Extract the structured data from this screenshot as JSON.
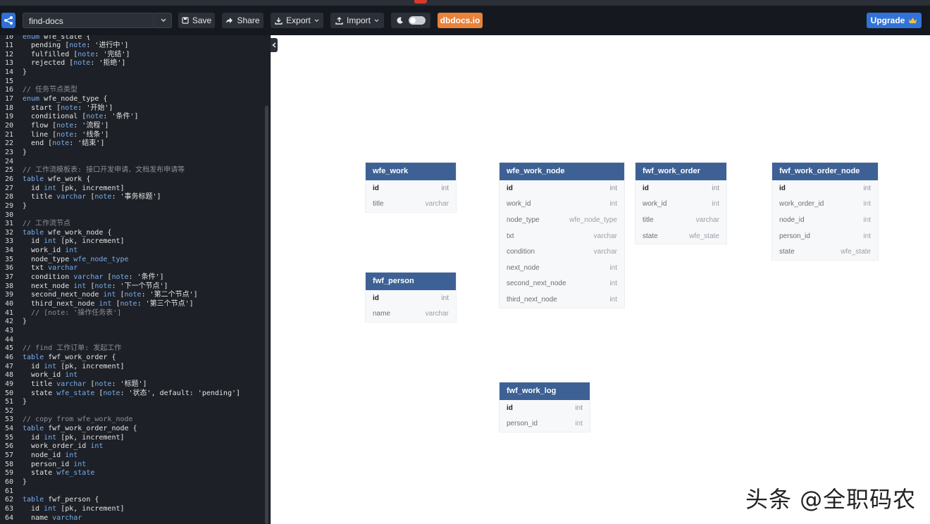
{
  "toolbar": {
    "doc_name": "find-docs",
    "save_label": "Save",
    "share_label": "Share",
    "export_label": "Export",
    "import_label": "Import",
    "dbdocs_label": "dbdocs.io",
    "upgrade_label": "Upgrade"
  },
  "editor": {
    "lines": [
      {
        "n": "10",
        "html": "<span class=\"kw\">enum</span> wfe_state {"
      },
      {
        "n": "11",
        "html": "  pending [<span class=\"kw\">note</span>: '进行中']"
      },
      {
        "n": "12",
        "html": "  fulfilled [<span class=\"kw\">note</span>: '完结']"
      },
      {
        "n": "13",
        "html": "  rejected [<span class=\"kw\">note</span>: '拒绝']"
      },
      {
        "n": "14",
        "html": "}"
      },
      {
        "n": "15",
        "html": ""
      },
      {
        "n": "16",
        "html": "<span class=\"cm\">// 任务节点类型</span>"
      },
      {
        "n": "17",
        "html": "<span class=\"kw\">enum</span> wfe_node_type {"
      },
      {
        "n": "18",
        "html": "  start [<span class=\"kw\">note</span>: '开始']"
      },
      {
        "n": "19",
        "html": "  conditional [<span class=\"kw\">note</span>: '条件']"
      },
      {
        "n": "20",
        "html": "  flow [<span class=\"kw\">note</span>: '流程']"
      },
      {
        "n": "21",
        "html": "  line [<span class=\"kw\">note</span>: '线条']"
      },
      {
        "n": "22",
        "html": "  end [<span class=\"kw\">note</span>: '结束']"
      },
      {
        "n": "23",
        "html": "}"
      },
      {
        "n": "24",
        "html": ""
      },
      {
        "n": "25",
        "html": "<span class=\"cm\">// 工作流模板表: 接口开发申请、文档发布申请等</span>"
      },
      {
        "n": "26",
        "html": "<span class=\"kw\">table</span> wfe_work {"
      },
      {
        "n": "27",
        "html": "  id <span class=\"kw\">int</span> [pk, increment]"
      },
      {
        "n": "28",
        "html": "  title <span class=\"kw\">varchar</span> [<span class=\"kw\">note</span>: '事务标题']"
      },
      {
        "n": "29",
        "html": "}"
      },
      {
        "n": "30",
        "html": ""
      },
      {
        "n": "31",
        "html": "<span class=\"cm\">// 工作流节点</span>"
      },
      {
        "n": "32",
        "html": "<span class=\"kw\">table</span> wfe_work_node {"
      },
      {
        "n": "33",
        "html": "  id <span class=\"kw\">int</span> [pk, increment]"
      },
      {
        "n": "34",
        "html": "  work_id <span class=\"kw\">int</span>"
      },
      {
        "n": "35",
        "html": "  node_type <span class=\"kw\">wfe_node_type</span>"
      },
      {
        "n": "36",
        "html": "  txt <span class=\"kw\">varchar</span>"
      },
      {
        "n": "37",
        "html": "  condition <span class=\"kw\">varchar</span> [<span class=\"kw\">note</span>: '条件']"
      },
      {
        "n": "38",
        "html": "  next_node <span class=\"kw\">int</span> [<span class=\"kw\">note</span>: '下一个节点']"
      },
      {
        "n": "39",
        "html": "  second_next_node <span class=\"kw\">int</span> [<span class=\"kw\">note</span>: '第二个节点']"
      },
      {
        "n": "40",
        "html": "  third_next_node <span class=\"kw\">int</span> [<span class=\"kw\">note</span>: '第三个节点']"
      },
      {
        "n": "41",
        "html": "  <span class=\"cm\">// [note: '操作任务表']</span>"
      },
      {
        "n": "42",
        "html": "}"
      },
      {
        "n": "43",
        "html": ""
      },
      {
        "n": "44",
        "html": ""
      },
      {
        "n": "45",
        "html": "<span class=\"cm\">// find 工作订单: 发起工作</span>"
      },
      {
        "n": "46",
        "html": "<span class=\"kw\">table</span> fwf_work_order {"
      },
      {
        "n": "47",
        "html": "  id <span class=\"kw\">int</span> [pk, increment]"
      },
      {
        "n": "48",
        "html": "  work_id <span class=\"kw\">int</span>"
      },
      {
        "n": "49",
        "html": "  title <span class=\"kw\">varchar</span> [<span class=\"kw\">note</span>: '标题']"
      },
      {
        "n": "50",
        "html": "  state <span class=\"kw\">wfe_state</span> [<span class=\"kw\">note</span>: '状态', default: 'pending']"
      },
      {
        "n": "51",
        "html": "}"
      },
      {
        "n": "52",
        "html": ""
      },
      {
        "n": "53",
        "html": "<span class=\"cm\">// copy from wfe_work_node</span>"
      },
      {
        "n": "54",
        "html": "<span class=\"kw\">table</span> fwf_work_order_node {"
      },
      {
        "n": "55",
        "html": "  id <span class=\"kw\">int</span> [pk, increment]"
      },
      {
        "n": "56",
        "html": "  work_order_id <span class=\"kw\">int</span>"
      },
      {
        "n": "57",
        "html": "  node_id <span class=\"kw\">int</span>"
      },
      {
        "n": "58",
        "html": "  person_id <span class=\"kw\">int</span>"
      },
      {
        "n": "59",
        "html": "  state <span class=\"kw\">wfe_state</span>"
      },
      {
        "n": "60",
        "html": "}"
      },
      {
        "n": "61",
        "html": ""
      },
      {
        "n": "62",
        "html": "<span class=\"kw\">table</span> fwf_person {"
      },
      {
        "n": "63",
        "html": "  id <span class=\"kw\">int</span> [pk, increment]"
      },
      {
        "n": "64",
        "html": "  name <span class=\"kw\">varchar</span>"
      }
    ]
  },
  "diagram": {
    "tables": [
      {
        "key": "wfe_work",
        "name": "wfe_work",
        "fields": [
          {
            "name": "id",
            "type": "int",
            "pk": true
          },
          {
            "name": "title",
            "type": "varchar"
          }
        ]
      },
      {
        "key": "wfe_work_node",
        "name": "wfe_work_node",
        "fields": [
          {
            "name": "id",
            "type": "int",
            "pk": true
          },
          {
            "name": "work_id",
            "type": "int"
          },
          {
            "name": "node_type",
            "type": "wfe_node_type"
          },
          {
            "name": "txt",
            "type": "varchar"
          },
          {
            "name": "condition",
            "type": "varchar"
          },
          {
            "name": "next_node",
            "type": "int"
          },
          {
            "name": "second_next_node",
            "type": "int"
          },
          {
            "name": "third_next_node",
            "type": "int"
          }
        ]
      },
      {
        "key": "fwf_work_order",
        "name": "fwf_work_order",
        "fields": [
          {
            "name": "id",
            "type": "int",
            "pk": true
          },
          {
            "name": "work_id",
            "type": "int"
          },
          {
            "name": "title",
            "type": "varchar"
          },
          {
            "name": "state",
            "type": "wfe_state"
          }
        ]
      },
      {
        "key": "fwf_work_order_node",
        "name": "fwf_work_order_node",
        "fields": [
          {
            "name": "id",
            "type": "int",
            "pk": true
          },
          {
            "name": "work_order_id",
            "type": "int"
          },
          {
            "name": "node_id",
            "type": "int"
          },
          {
            "name": "person_id",
            "type": "int"
          },
          {
            "name": "state",
            "type": "wfe_state"
          }
        ]
      },
      {
        "key": "fwf_person",
        "name": "fwf_person",
        "fields": [
          {
            "name": "id",
            "type": "int",
            "pk": true
          },
          {
            "name": "name",
            "type": "varchar"
          }
        ]
      },
      {
        "key": "fwf_work_log",
        "name": "fwf_work_log",
        "fields": [
          {
            "name": "id",
            "type": "int",
            "pk": true
          },
          {
            "name": "person_id",
            "type": "int"
          }
        ]
      }
    ]
  },
  "watermark": "头条 @全职码农",
  "colors": {
    "toolbar_bg": "#15191f",
    "editor_bg": "#1d2026",
    "keyword": "#78aef0",
    "table_header": "#3d6194",
    "dbdocs_orange": "#e9823a",
    "upgrade_blue": "#3173d8"
  },
  "icons": [
    "share-diagram-icon",
    "chevron-down-icon",
    "save-icon",
    "share-icon",
    "export-icon",
    "import-icon",
    "moon-icon",
    "crown-icon",
    "chevron-left-icon"
  ]
}
